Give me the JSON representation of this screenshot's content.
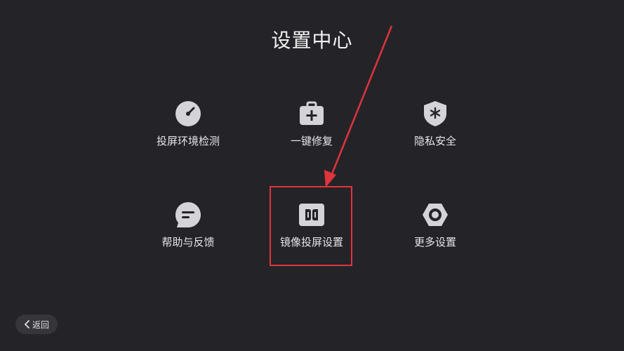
{
  "page": {
    "title": "设置中心"
  },
  "tiles": [
    {
      "label": "投屏环境检测",
      "icon": "speedometer-icon"
    },
    {
      "label": "一键修复",
      "icon": "first-aid-kit-icon"
    },
    {
      "label": "隐私安全",
      "icon": "shield-icon"
    },
    {
      "label": "帮助与反馈",
      "icon": "chat-bubble-icon"
    },
    {
      "label": "镜像投屏设置",
      "icon": "mirror-cast-icon"
    },
    {
      "label": "更多设置",
      "icon": "hex-gear-icon"
    }
  ],
  "back_button": {
    "label": "返回",
    "icon": "chevron-left-icon"
  },
  "colors": {
    "background": "#242428",
    "icon_fill": "#d4d4d8",
    "highlight": "#e0343c",
    "text": "#e6e6ea"
  }
}
